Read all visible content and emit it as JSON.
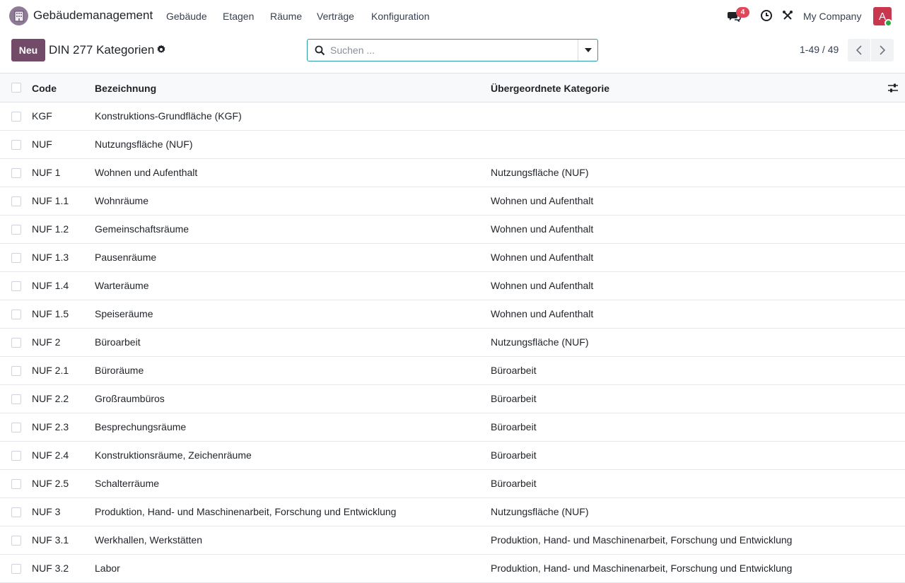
{
  "navbar": {
    "app_name": "Gebäudemanagement",
    "menu": [
      "Gebäude",
      "Etagen",
      "Räume",
      "Verträge",
      "Konfiguration"
    ],
    "messages_count": "4",
    "company": "My Company",
    "avatar_letter": "A"
  },
  "control_panel": {
    "new_label": "Neu",
    "title": "DIN 277 Kategorien",
    "search_placeholder": "Suchen ...",
    "pager": "1-49 / 49"
  },
  "table": {
    "columns": [
      "Code",
      "Bezeichnung",
      "Übergeordnete Kategorie"
    ],
    "rows": [
      {
        "code": "KGF",
        "name": "Konstruktions-Grundfläche (KGF)",
        "parent": ""
      },
      {
        "code": "NUF",
        "name": "Nutzungsfläche (NUF)",
        "parent": ""
      },
      {
        "code": "NUF 1",
        "name": "Wohnen und Aufenthalt",
        "parent": "Nutzungsfläche (NUF)"
      },
      {
        "code": "NUF 1.1",
        "name": "Wohnräume",
        "parent": "Wohnen und Aufenthalt"
      },
      {
        "code": "NUF 1.2",
        "name": "Gemeinschaftsräume",
        "parent": "Wohnen und Aufenthalt"
      },
      {
        "code": "NUF 1.3",
        "name": "Pausenräume",
        "parent": "Wohnen und Aufenthalt"
      },
      {
        "code": "NUF 1.4",
        "name": "Warteräume",
        "parent": "Wohnen und Aufenthalt"
      },
      {
        "code": "NUF 1.5",
        "name": "Speiseräume",
        "parent": "Wohnen und Aufenthalt"
      },
      {
        "code": "NUF 2",
        "name": "Büroarbeit",
        "parent": "Nutzungsfläche (NUF)"
      },
      {
        "code": "NUF 2.1",
        "name": "Büroräume",
        "parent": "Büroarbeit"
      },
      {
        "code": "NUF 2.2",
        "name": "Großraumbüros",
        "parent": "Büroarbeit"
      },
      {
        "code": "NUF 2.3",
        "name": "Besprechungsräume",
        "parent": "Büroarbeit"
      },
      {
        "code": "NUF 2.4",
        "name": "Konstruktionsräume, Zeichenräume",
        "parent": "Büroarbeit"
      },
      {
        "code": "NUF 2.5",
        "name": "Schalterräume",
        "parent": "Büroarbeit"
      },
      {
        "code": "NUF 3",
        "name": "Produktion, Hand- und Maschinenarbeit, Forschung und Entwicklung",
        "parent": "Nutzungsfläche (NUF)"
      },
      {
        "code": "NUF 3.1",
        "name": "Werkhallen, Werkstätten",
        "parent": "Produktion, Hand- und Maschinenarbeit, Forschung und Entwicklung"
      },
      {
        "code": "NUF 3.2",
        "name": "Labor",
        "parent": "Produktion, Hand- und Maschinenarbeit, Forschung und Entwicklung"
      }
    ]
  },
  "colors": {
    "brand": "#714b67",
    "search_border": "#2b9aa6",
    "badge": "#e0485a",
    "avatar": "#c7384f"
  },
  "icons": [
    "building-icon",
    "chat-icon",
    "clock-icon",
    "tools-icon",
    "gear-icon",
    "search-icon",
    "caret-down-icon",
    "chevron-left-icon",
    "chevron-right-icon",
    "column-settings-icon"
  ]
}
